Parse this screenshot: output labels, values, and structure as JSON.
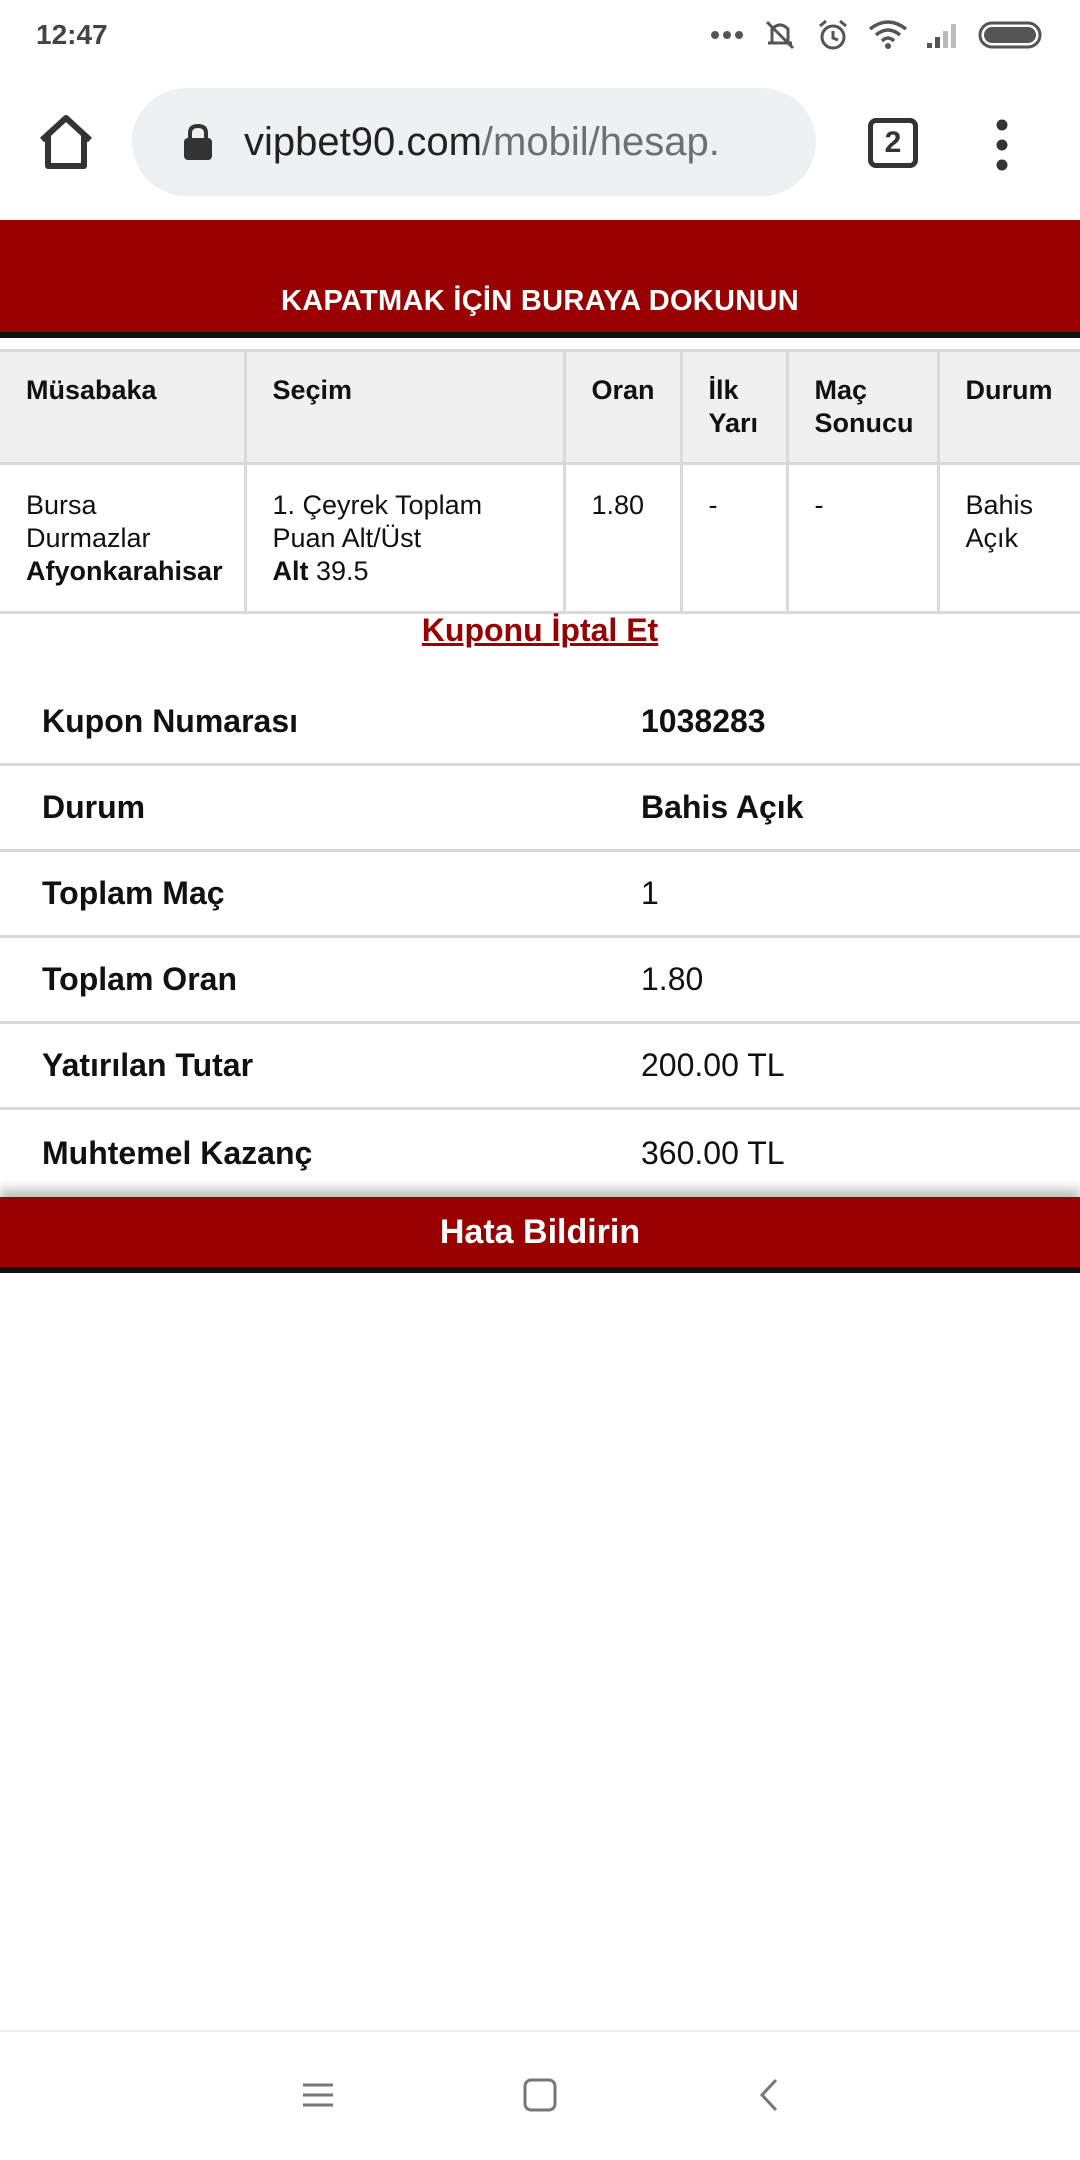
{
  "status_bar": {
    "time": "12:47"
  },
  "browser": {
    "url_domain": "vipbet90.com",
    "url_path": "/mobil/hesap.",
    "tab_count": "2"
  },
  "close_banner": "KAPATMAK İÇİN BURAYA DOKUNUN",
  "bet_table": {
    "headers": [
      "Müsabaka",
      "Seçim",
      "Oran",
      "İlk Yarı",
      "Maç Sonucu",
      "Durum"
    ],
    "row": {
      "home_team": "Bursa Durmazlar",
      "away_team": "Afyonkarahisar",
      "market": "1. Çeyrek Toplam Puan Alt/Üst",
      "pick": "Alt",
      "line": " 39.5",
      "odds": "1.80",
      "first_half": "-",
      "match_result": "-",
      "status": "Bahis Açık"
    }
  },
  "cancel_link": "Kuponu İptal Et",
  "summary": [
    {
      "label": "Kupon Numarası",
      "value": "1038283"
    },
    {
      "label": "Durum",
      "value": "Bahis Açık"
    },
    {
      "label": "Toplam Maç",
      "value": "1"
    },
    {
      "label": "Toplam Oran",
      "value": "1.80"
    },
    {
      "label": "Yatırılan Tutar",
      "value": "200.00 TL"
    },
    {
      "label": "Muhtemel Kazanç",
      "value": "360.00 TL"
    }
  ],
  "report_button": "Hata Bildirin",
  "colors": {
    "brand_red": "#990000",
    "header_gray": "#f0f0f0",
    "url_bar_bg": "#eef0f2"
  }
}
